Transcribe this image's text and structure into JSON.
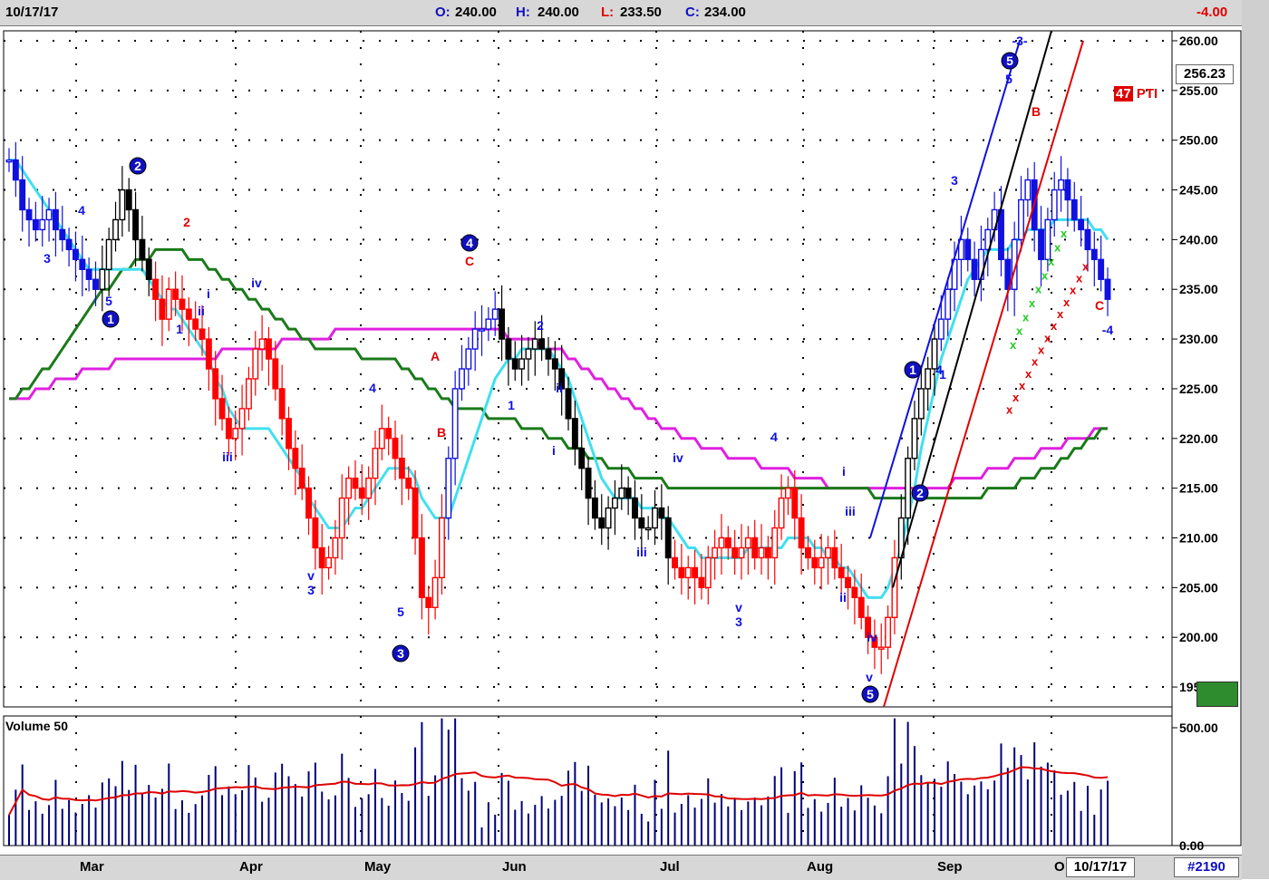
{
  "header": {
    "date": "10/17/17",
    "open_label": "O:",
    "open": "240.00",
    "high_label": "H:",
    "high": "240.00",
    "low_label": "L:",
    "low": "233.50",
    "close_label": "C:",
    "close": "234.00",
    "change": "-4.00"
  },
  "last_price_box": "256.23",
  "pti": {
    "value": "47",
    "label": "PTI"
  },
  "volume_label": "Volume 50",
  "footer": {
    "months": [
      "Mar",
      "Apr",
      "May",
      "Jun",
      "Jul",
      "Aug",
      "Sep",
      "O"
    ],
    "date_box": "10/17/17",
    "bar_count": "#2190"
  },
  "colors": {
    "up_down_black": "#000000",
    "red_bars": "#ff0000",
    "blue_bars": "#1010e0",
    "ma_cyan": "#40e0f0",
    "ma_green": "#1a7a1a",
    "ma_magenta": "#e020e0",
    "volume": "#00007a",
    "volume_ma": "#e00000"
  },
  "chart_data": [
    {
      "type": "candlestick",
      "y_axis_ticks": [
        "260.00",
        "255.00",
        "250.00",
        "245.00",
        "240.00",
        "235.00",
        "230.00",
        "225.00",
        "220.00",
        "215.00",
        "210.00",
        "205.00",
        "200.00",
        "195.00"
      ],
      "ylim": [
        193,
        261
      ],
      "x_ticks": [
        "Mar",
        "Apr",
        "May",
        "Jun",
        "Jul",
        "Aug",
        "Sep",
        "O"
      ],
      "close_series": [
        248,
        246,
        243,
        242,
        241,
        242,
        243,
        241,
        240,
        239,
        238,
        237,
        236,
        235,
        237,
        240,
        242,
        245,
        243,
        240,
        238,
        236,
        234,
        232,
        235,
        234,
        233,
        232,
        231,
        230,
        227,
        224,
        222,
        220,
        221,
        223,
        226,
        229,
        230,
        228,
        225,
        222,
        219,
        217,
        215,
        212,
        209,
        207,
        208,
        210,
        214,
        216,
        215,
        214,
        216,
        219,
        221,
        220,
        218,
        216,
        215,
        210,
        204,
        203,
        206,
        212,
        218,
        225,
        227,
        229,
        231,
        231,
        232,
        233,
        230,
        228,
        227,
        228,
        229,
        230,
        229,
        228,
        227,
        225,
        222,
        219,
        217,
        214,
        212,
        211,
        213,
        214,
        215,
        214,
        212,
        211,
        211,
        213,
        212,
        208,
        207,
        206,
        207,
        206,
        205,
        208,
        209,
        210,
        209,
        208,
        209,
        210,
        208,
        209,
        208,
        211,
        214,
        215,
        212,
        209,
        208,
        207,
        208,
        209,
        207,
        206,
        205,
        204,
        202,
        200,
        199,
        199,
        202,
        208,
        212,
        218,
        222,
        225,
        227,
        230,
        232,
        235,
        238,
        240,
        238,
        236,
        239,
        241,
        243,
        238,
        235,
        240,
        244,
        246,
        241,
        238,
        242,
        245,
        246,
        244,
        242,
        241,
        239,
        238,
        236,
        234
      ],
      "ma_cyan": [
        248,
        248,
        247,
        246,
        245,
        244,
        243,
        242,
        241,
        240,
        239,
        238,
        237,
        237,
        237,
        237,
        237,
        237,
        237,
        237,
        237,
        236,
        235,
        234,
        233,
        233,
        232,
        231,
        230,
        229,
        228,
        226,
        225,
        223,
        222,
        221,
        221,
        221,
        221,
        221,
        220,
        219,
        218,
        217,
        216,
        214,
        213,
        212,
        211,
        211,
        211,
        212,
        213,
        213,
        214,
        215,
        216,
        217,
        217,
        217,
        217,
        216,
        214,
        213,
        212,
        212,
        212,
        214,
        216,
        218,
        220,
        222,
        224,
        226,
        227,
        228,
        228,
        229,
        229,
        229,
        229,
        229,
        228,
        227,
        226,
        224,
        222,
        220,
        218,
        216,
        215,
        214,
        214,
        214,
        214,
        213,
        213,
        213,
        212,
        212,
        211,
        210,
        209,
        209,
        208,
        208,
        208,
        208,
        208,
        208,
        208,
        209,
        209,
        209,
        209,
        209,
        209,
        210,
        210,
        210,
        210,
        209,
        209,
        208,
        208,
        207,
        207,
        206,
        205,
        204,
        204,
        204,
        205,
        207,
        209,
        212,
        215,
        219,
        222,
        225,
        228,
        230,
        232,
        234,
        236,
        237,
        238,
        239,
        239,
        239,
        239,
        240,
        240,
        241,
        241,
        241,
        241,
        242,
        242,
        242,
        242,
        242,
        242,
        241,
        241,
        240
      ],
      "ma_green": [
        224,
        224,
        225,
        225,
        226,
        227,
        227,
        228,
        229,
        230,
        231,
        232,
        233,
        234,
        235,
        235,
        236,
        237,
        237,
        238,
        238,
        238,
        239,
        239,
        239,
        239,
        239,
        238,
        238,
        238,
        237,
        237,
        236,
        236,
        235,
        235,
        234,
        234,
        233,
        233,
        232,
        232,
        231,
        231,
        230,
        230,
        229,
        229,
        229,
        229,
        229,
        229,
        229,
        228,
        228,
        228,
        228,
        228,
        228,
        227,
        227,
        226,
        226,
        225,
        225,
        224,
        224,
        223,
        223,
        223,
        223,
        223,
        222,
        222,
        222,
        222,
        222,
        221,
        221,
        221,
        221,
        220,
        220,
        220,
        219,
        219,
        219,
        218,
        218,
        218,
        217,
        217,
        217,
        217,
        216,
        216,
        216,
        216,
        216,
        215,
        215,
        215,
        215,
        215,
        215,
        215,
        215,
        215,
        215,
        215,
        215,
        215,
        215,
        215,
        215,
        215,
        215,
        215,
        215,
        215,
        215,
        215,
        215,
        215,
        215,
        215,
        215,
        215,
        215,
        215,
        214,
        214,
        214,
        214,
        214,
        214,
        214,
        214,
        214,
        214,
        214,
        214,
        214,
        214,
        214,
        214,
        214,
        215,
        215,
        215,
        215,
        215,
        216,
        216,
        216,
        217,
        217,
        217,
        218,
        218,
        219,
        219,
        220,
        220,
        221,
        221
      ],
      "ma_magenta": [
        224,
        224,
        224,
        224,
        225,
        225,
        225,
        226,
        226,
        226,
        226,
        227,
        227,
        227,
        227,
        227,
        228,
        228,
        228,
        228,
        228,
        228,
        228,
        228,
        228,
        228,
        228,
        228,
        228,
        228,
        228,
        228,
        229,
        229,
        229,
        229,
        229,
        229,
        229,
        229,
        229,
        230,
        230,
        230,
        230,
        230,
        230,
        230,
        230,
        231,
        231,
        231,
        231,
        231,
        231,
        231,
        231,
        231,
        231,
        231,
        231,
        231,
        231,
        231,
        231,
        231,
        231,
        231,
        231,
        231,
        231,
        231,
        231,
        231,
        231,
        230,
        230,
        230,
        230,
        230,
        229,
        229,
        229,
        229,
        228,
        228,
        227,
        227,
        226,
        226,
        225,
        225,
        224,
        224,
        223,
        223,
        222,
        222,
        221,
        221,
        221,
        220,
        220,
        220,
        219,
        219,
        219,
        219,
        218,
        218,
        218,
        218,
        218,
        217,
        217,
        217,
        217,
        217,
        216,
        216,
        216,
        216,
        216,
        215,
        215,
        215,
        215,
        215,
        215,
        215,
        215,
        215,
        215,
        215,
        215,
        215,
        215,
        215,
        215,
        215,
        215,
        215,
        216,
        216,
        216,
        216,
        216,
        217,
        217,
        217,
        217,
        218,
        218,
        218,
        218,
        219,
        219,
        219,
        219,
        220,
        220,
        220,
        220,
        221,
        221,
        221
      ],
      "wave_labels": [
        "2",
        "3",
        "4",
        "5",
        "1",
        "2",
        "1",
        "i",
        "ii",
        "iii",
        "iv",
        "v",
        "3",
        "4",
        "5",
        "3",
        "A",
        "B",
        "C",
        "4",
        "1",
        "2",
        "i",
        "ii",
        "iii",
        "iv",
        "v",
        "3",
        "4",
        "i",
        "ii",
        "iii",
        "iv",
        "v",
        "5",
        "5",
        "1",
        "2",
        "3",
        "4",
        "5",
        "1",
        "B",
        "C",
        "-4",
        "-3-"
      ]
    },
    {
      "type": "bar",
      "title": "Volume 50",
      "y_axis_ticks": [
        "500.00",
        "0.00"
      ],
      "ylim": [
        0,
        550
      ]
    }
  ]
}
